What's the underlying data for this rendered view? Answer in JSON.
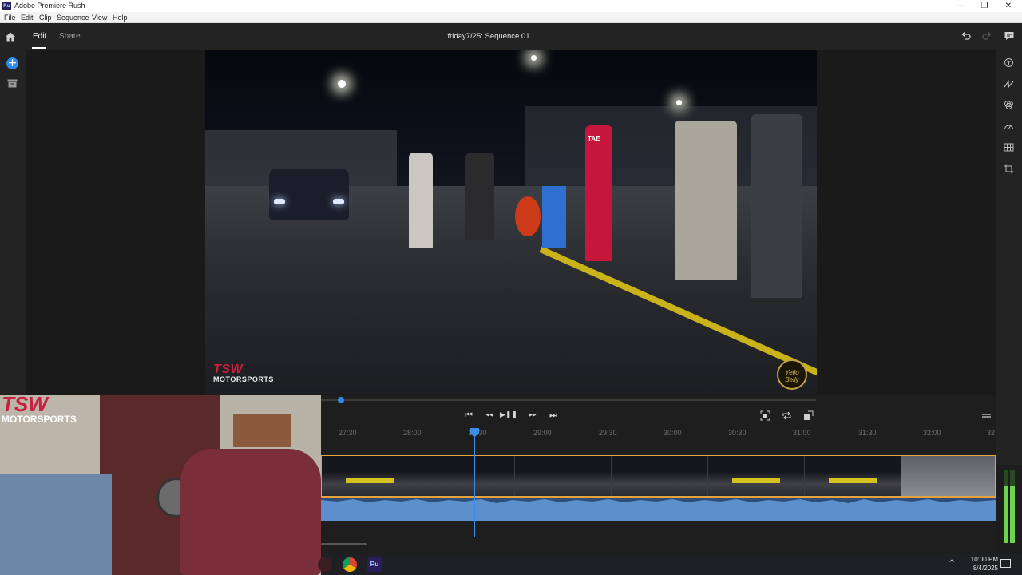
{
  "window": {
    "app_icon_text": "Ru",
    "title": "Adobe Premiere Rush",
    "minimize": "—",
    "restore": "❐",
    "close": "✕"
  },
  "menu": {
    "items": [
      "File",
      "Edit",
      "Clip",
      "Sequence",
      "View",
      "Help"
    ]
  },
  "header": {
    "tabs": [
      "Edit",
      "Share"
    ],
    "active_tab": "Edit",
    "sequence_title": "friday7/25: Sequence 01"
  },
  "left_rail": {
    "add_symbol": "+"
  },
  "video": {
    "watermark_logo_mark": "TSW",
    "watermark_logo_text": "MOTORSPORTS",
    "badge_text": "Yello Belly",
    "shirt_text": "TAE"
  },
  "webcam": {
    "logo_mark": "TSW",
    "logo_text": "MOTORSPORTS"
  },
  "timeline": {
    "controls": {
      "go_start": "⏮",
      "step_back": "◂◂",
      "play_pause": "▶❚❚",
      "step_forward": "▸▸",
      "go_end": "⏭"
    },
    "ruler": [
      "27:30",
      "28:00",
      "28:30",
      "29:00",
      "29:30",
      "30:00",
      "30:30",
      "31:00",
      "31:30",
      "32:00",
      "32"
    ],
    "scrub_position": 0.04
  },
  "meters": {
    "left_level": 0.78,
    "right_level": 0.78
  },
  "taskbar": {
    "time": "10:00 PM",
    "date": "8/4/2025",
    "chevron": "^"
  },
  "colors": {
    "accent": "#2d8ceb",
    "clip_border": "#e7a23a",
    "audio": "#5d8fcd",
    "brand_red": "#c8203f"
  }
}
